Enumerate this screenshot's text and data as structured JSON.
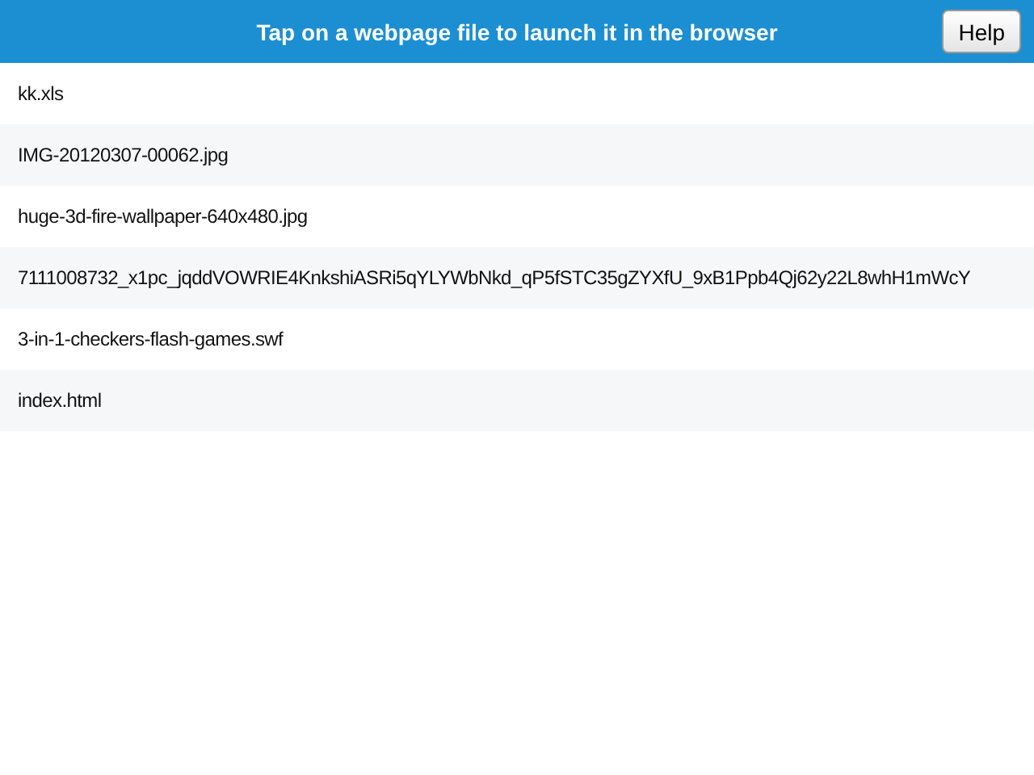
{
  "header": {
    "title": "Tap on a webpage file to launch it in the browser",
    "help_button": "Help"
  },
  "files": [
    {
      "name": "kk.xls"
    },
    {
      "name": "IMG-20120307-00062.jpg"
    },
    {
      "name": "huge-3d-fire-wallpaper-640x480.jpg"
    },
    {
      "name": "7111008732_x1pc_jqddVOWRIE4KnkshiASRi5qYLYWbNkd_qP5fSTC35gZYXfU_9xB1Ppb4Qj62y22L8whH1mWcY"
    },
    {
      "name": "3-in-1-checkers-flash-games.swf"
    },
    {
      "name": "index.html"
    }
  ]
}
